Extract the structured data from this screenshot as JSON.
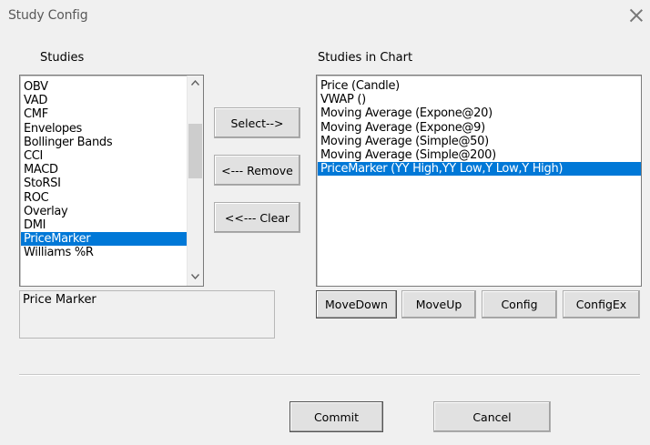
{
  "window": {
    "title": "Study Config"
  },
  "studies": {
    "label": "Studies",
    "items": [
      "OBV",
      "VAD",
      "CMF",
      "Envelopes",
      "Bollinger Bands",
      "CCI",
      "MACD",
      "StoRSI",
      "ROC",
      "Overlay",
      "DMI",
      "PriceMarker",
      "Williams %R"
    ],
    "selected": "PriceMarker",
    "description": "Price Marker"
  },
  "chart": {
    "label": "Studies in Chart",
    "items": [
      "Price (Candle)",
      "VWAP ()",
      "Moving Average (Expone@20)",
      "Moving Average (Expone@9)",
      "Moving Average (Simple@50)",
      "Moving Average (Simple@200)",
      "PriceMarker (YY High,YY Low,Y Low,Y High)"
    ],
    "selected": "PriceMarker (YY High,YY Low,Y Low,Y High)"
  },
  "middle_buttons": {
    "select": "Select-->",
    "remove": "<--- Remove",
    "clear": "<<--- Clear"
  },
  "chart_buttons": {
    "move_down": "MoveDown",
    "move_up": "MoveUp",
    "config": "Config",
    "config_ex": "ConfigEx"
  },
  "footer": {
    "commit": "Commit",
    "cancel": "Cancel"
  },
  "colors": {
    "selection": "#0078d7",
    "background": "#f0f0f0"
  }
}
